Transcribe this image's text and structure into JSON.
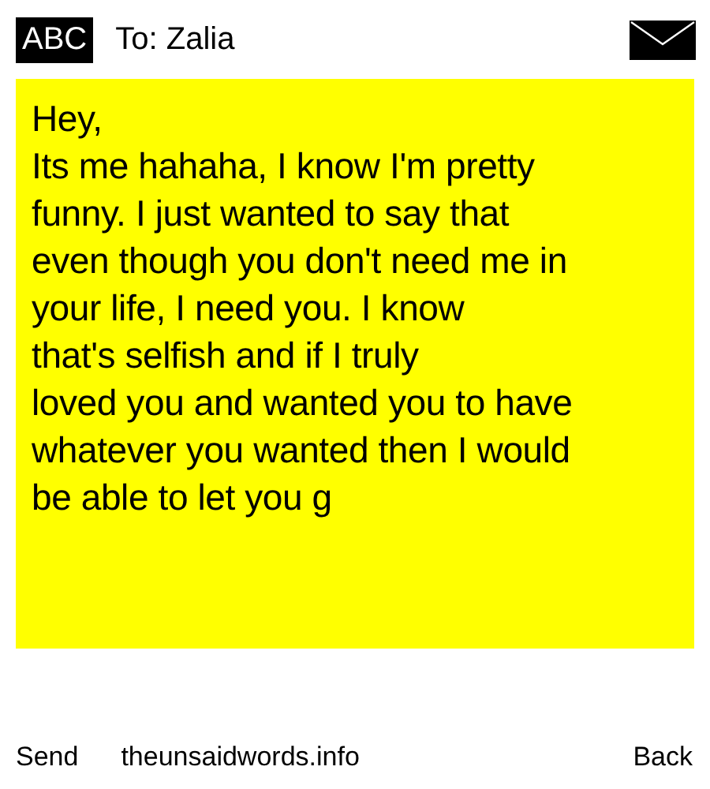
{
  "header": {
    "input_mode": "ABC",
    "recipient": "To: Zalia"
  },
  "message": {
    "text": "Hey,\nIts me hahaha, I know I'm pretty\nfunny. I just wanted to say that\neven though you don't need me in\nyour life, I need you. I know\nthat's selfish and if I truly\nloved you and wanted you to have\nwhatever you wanted then I would\nbe able to let you g"
  },
  "softkeys": {
    "left": "Send",
    "center": "theunsaidwords.info",
    "right": "Back"
  }
}
